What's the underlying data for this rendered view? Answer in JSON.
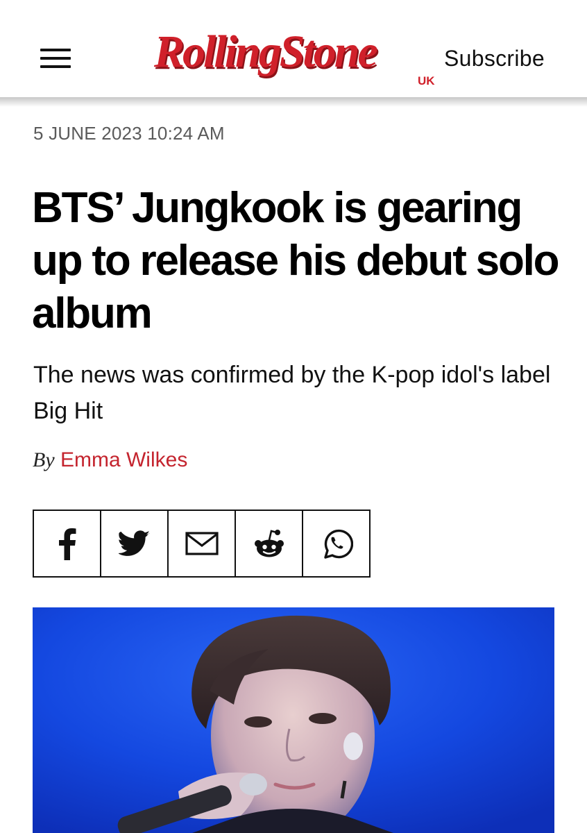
{
  "status_bar": {
    "icon": "filter-funnel-icon",
    "icon_color": "#1aa38a"
  },
  "header": {
    "menu_icon": "hamburger-menu-icon",
    "logo_text": "RollingStone",
    "logo_region": "UK",
    "logo_color": "#d0202a",
    "subscribe_label": "Subscribe"
  },
  "article": {
    "dateline": "5 JUNE 2023 10:24 AM",
    "headline": "BTS’ Jungkook is gearing up to release his debut solo album",
    "dek": "The news was confirmed by the K-pop idol's label Big Hit",
    "byline_prefix": "By",
    "author": "Emma Wilkes",
    "author_color": "#c4242e"
  },
  "share": [
    {
      "icon": "facebook-icon"
    },
    {
      "icon": "twitter-icon"
    },
    {
      "icon": "email-icon"
    },
    {
      "icon": "reddit-icon"
    },
    {
      "icon": "whatsapp-icon"
    }
  ],
  "hero_image": {
    "subject": "performer-with-microphone",
    "background_color": "#1448e0"
  }
}
